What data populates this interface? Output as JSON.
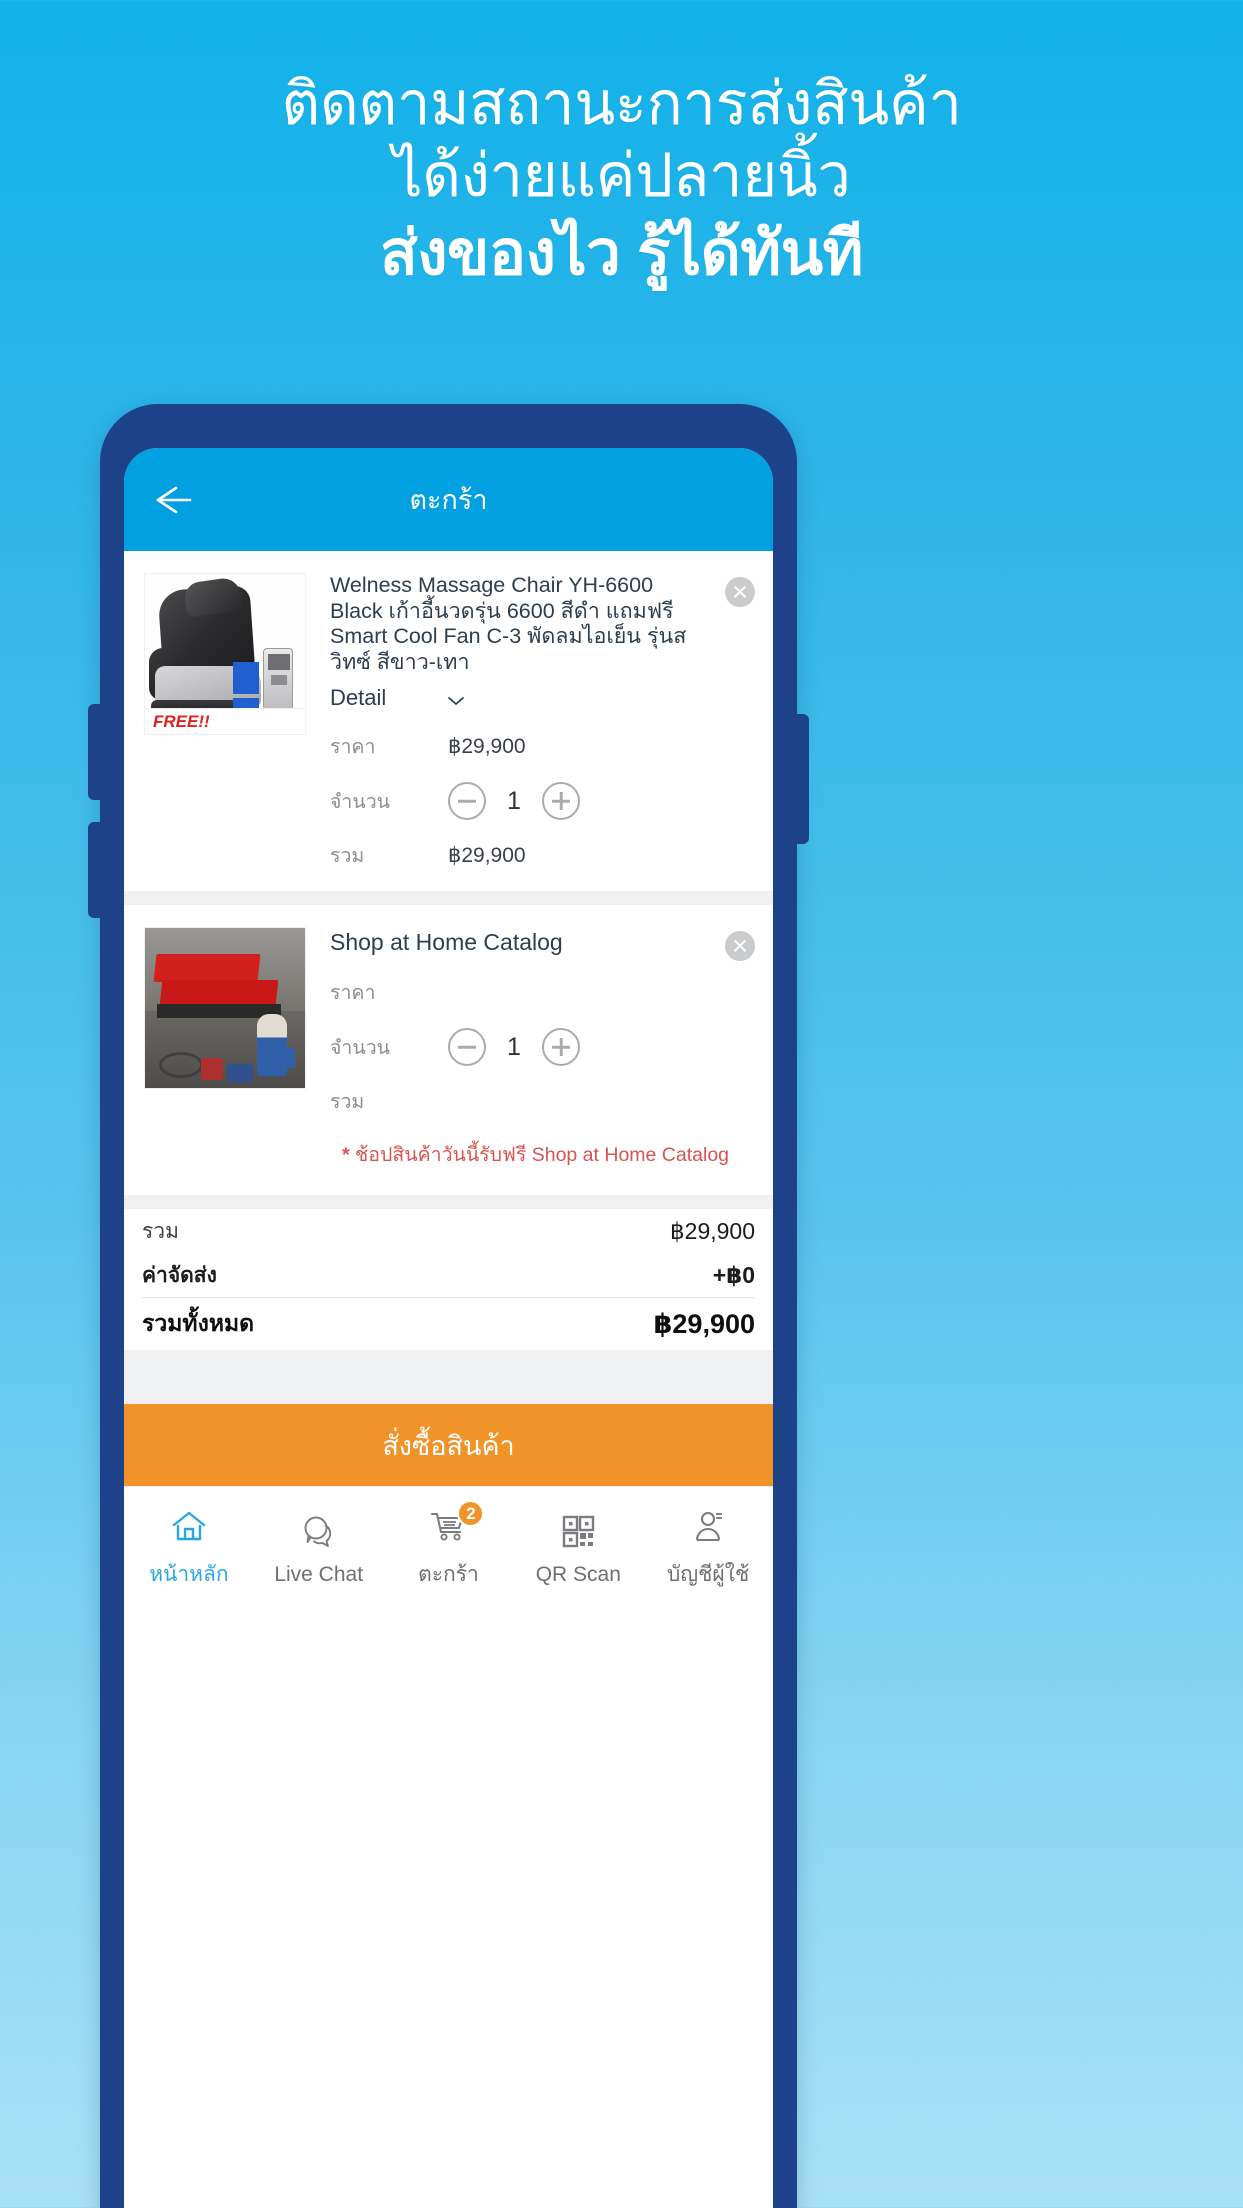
{
  "promo": {
    "line1": "ติดตามสถานะการส่งสินค้า",
    "line2": "ได้ง่ายแค่ปลายนิ้ว",
    "line3": "ส่งของไว รู้ได้ทันที"
  },
  "colors": {
    "page_bg_top": "#12b2ea",
    "page_bg_bottom": "#a9e1f7",
    "phone_frame": "#1d4289",
    "app_header": "#00a0e1",
    "cta_orange": "#f0942a",
    "accent_blue": "#29a8df",
    "note_red": "#d9534f"
  },
  "app": {
    "header": {
      "title": "ตะกร้า",
      "back_icon": "arrow-left-icon"
    },
    "cart_items": [
      {
        "title": "Welness Massage Chair YH-6600 Black เก้าอี้นวดรุ่น 6600 สีดำ แถมฟรี Smart Cool Fan C-3 พัดลมไอเย็น รุ่นสวิทซ์ สีขาว-เทา",
        "detail_label": "Detail",
        "price_label": "ราคา",
        "price_value": "฿29,900",
        "qty_label": "จำนวน",
        "qty_value": "1",
        "total_label": "รวม",
        "total_value": "฿29,900",
        "image_caption": "FREE!!"
      },
      {
        "title": "Shop at Home Catalog",
        "price_label": "ราคา",
        "price_value": "",
        "qty_label": "จำนวน",
        "qty_value": "1",
        "total_label": "รวม",
        "total_value": ""
      }
    ],
    "promo_note": {
      "star": "*",
      "text": "ช้อปสินค้าวันนี้รับฟรี Shop at Home Catalog"
    },
    "summary": {
      "subtotal_label": "รวม",
      "subtotal_value": "฿29,900",
      "shipping_label": "ค่าจัดส่ง",
      "shipping_value": "+฿0",
      "grand_label": "รวมทั้งหมด",
      "grand_value": "฿29,900"
    },
    "cta_label": "สั่งซื้อสินค้า",
    "bottom_nav": [
      {
        "label": "หน้าหลัก",
        "icon": "home-icon"
      },
      {
        "label": "Live Chat",
        "icon": "chat-bubble-icon"
      },
      {
        "label": "ตะกร้า",
        "icon": "cart-icon",
        "badge": "2"
      },
      {
        "label": "QR Scan",
        "icon": "qr-code-icon"
      },
      {
        "label": "บัญชีผู้ใช้",
        "icon": "user-account-icon"
      }
    ]
  }
}
